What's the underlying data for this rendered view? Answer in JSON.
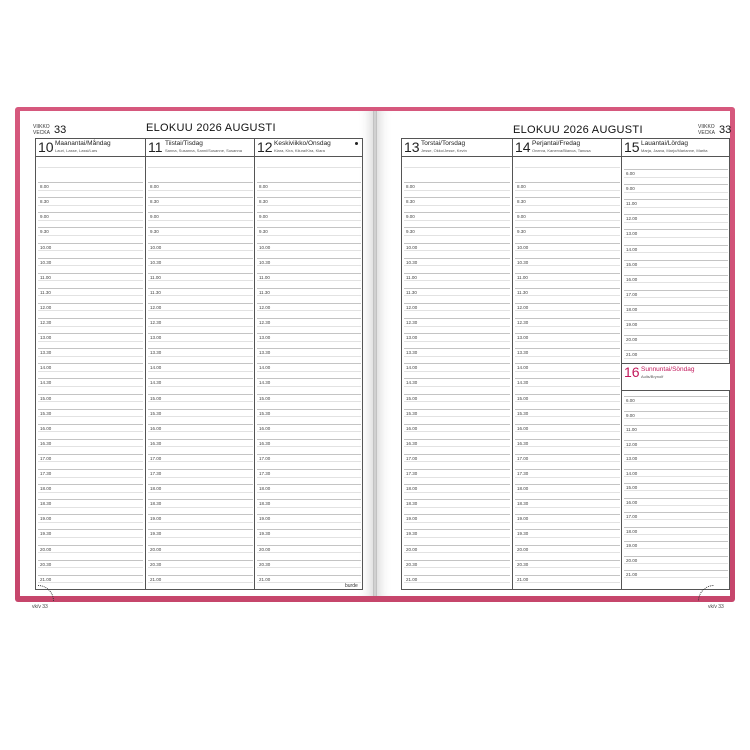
{
  "header": {
    "week_label_fi": "VIIKKO",
    "week_label_sv": "VECKA",
    "week_number": "33",
    "month_title": "ELOKUU 2026 AUGUSTI"
  },
  "left_days": [
    {
      "num": "10",
      "name": "Maanantai/Måndag",
      "names": "Lauri, Lasse, Lassi/Lars"
    },
    {
      "num": "11",
      "name": "Tiistai/Tisdag",
      "names": "Sanna, Susanna, Sanni/Susanne, Susanna"
    },
    {
      "num": "12",
      "name": "Keskiviikko/Onsdag",
      "names": "Klara, Kira, Kiiura/Kira, Klara"
    }
  ],
  "right_days": [
    {
      "num": "13",
      "name": "Torstai/Torsdag",
      "names": "Jesse, Okko/Jesse, Kevin"
    },
    {
      "num": "14",
      "name": "Perjantai/Fredag",
      "names": "Onerva, Kanerva/Bianca, Tanusa"
    },
    {
      "num": "15",
      "name": "Lauantai/Lördag",
      "names": "Marja, Jaana, Marjo/Marianne, Marita"
    }
  ],
  "sunday": {
    "num": "16",
    "name": "Sunnuntai/Söndag",
    "names": "Aulis/Brynolf"
  },
  "times": [
    "8.00",
    "8.30",
    "9.00",
    "9.30",
    "10.00",
    "10.30",
    "11.00",
    "11.30",
    "12.00",
    "12.30",
    "13.00",
    "13.30",
    "14.00",
    "14.30",
    "15.00",
    "15.30",
    "16.00",
    "16.30",
    "17.00",
    "17.30",
    "18.00",
    "18.30",
    "19.00",
    "19.30",
    "20.00",
    "20.30",
    "21.00"
  ],
  "sat_times": [
    "6.00",
    "9.00",
    "11.00",
    "12.00",
    "13.00",
    "14.00",
    "15.00",
    "16.00",
    "17.00",
    "18.00",
    "19.00",
    "20.00",
    "21.00"
  ],
  "sun_times": [
    "6.00",
    "9.00",
    "11.00",
    "12.00",
    "13.00",
    "14.00",
    "15.00",
    "16.00",
    "17.00",
    "18.00",
    "19.00",
    "20.00",
    "21.00"
  ],
  "brand": "burde",
  "page_code_left": "vk/v 33",
  "page_code_right": "vk/v 33",
  "colors": {
    "cover": "#d24a72",
    "sunday": "#c2185b"
  }
}
